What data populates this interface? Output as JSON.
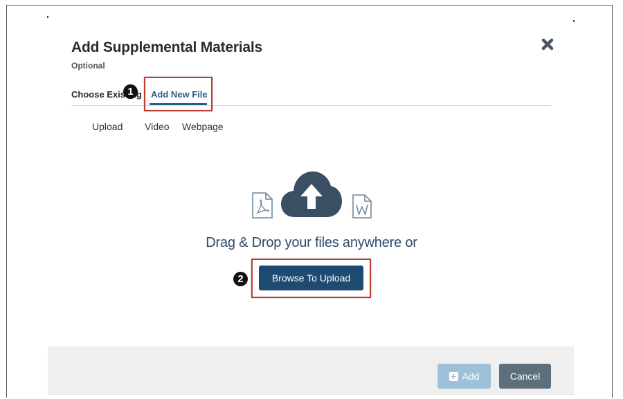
{
  "dialog": {
    "title": "Add Supplemental Materials",
    "subtitle": "Optional"
  },
  "tabs": [
    {
      "label": "Choose Existing",
      "selected": false
    },
    {
      "label": "Add New File",
      "selected": true
    }
  ],
  "subtabs": [
    {
      "label": "Upload"
    },
    {
      "label": "Video"
    },
    {
      "label": "Webpage"
    }
  ],
  "dropzone": {
    "text": "Drag & Drop your files anywhere or",
    "browse_label": "Browse To Upload",
    "icons": [
      "pdf-file-icon",
      "cloud-upload-icon",
      "word-file-icon"
    ]
  },
  "annotations": {
    "step1": "1",
    "step2": "2"
  },
  "footer": {
    "add_label": "Add",
    "cancel_label": "Cancel"
  },
  "colors": {
    "primary": "#1f4a72",
    "tab_active": "#2e5c8a",
    "highlight": "#c0392b",
    "disabled_button": "#9ec0d9",
    "cancel_button": "#5d6f7a",
    "footer_bg": "#efefef"
  }
}
